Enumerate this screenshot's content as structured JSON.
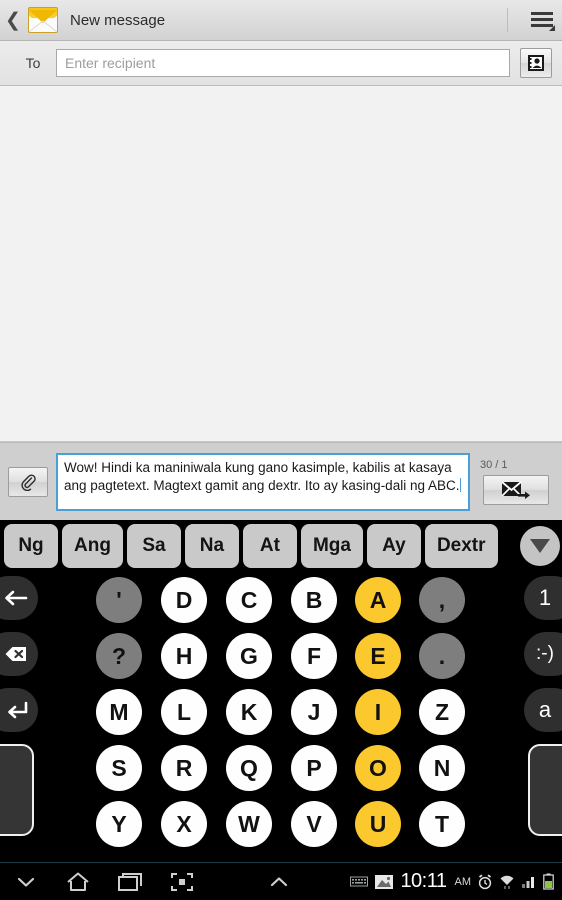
{
  "titlebar": {
    "back_icon": "back-chevron-icon",
    "app_icon": "envelope-icon",
    "title": "New message",
    "menu_icon": "hamburger-menu-icon"
  },
  "recipient": {
    "label": "To",
    "placeholder": "Enter recipient",
    "value": "",
    "contacts_icon": "contacts-person-icon"
  },
  "compose": {
    "attach_icon": "paperclip-icon",
    "message_text": "Wow! Hindi ka maniniwala kung gano kasimple, kabilis at kasaya ang pagtetext. Magtext gamit ang dextr. Ito ay kasing-dali ng ABC.",
    "char_count": "30 / 1",
    "send_icon": "send-envelope-arrow-icon",
    "focus_color": "#4a9fd8"
  },
  "suggestions": {
    "items": [
      "Ng",
      "Ang",
      "Sa",
      "Na",
      "At",
      "Mga",
      "Ay",
      "Dextr"
    ],
    "more_icon": "chevron-down-icon"
  },
  "keyboard": {
    "colors": {
      "background": "#000000",
      "letter_key": "#fefefe",
      "vowel_key": "#fbc82e",
      "punct_key": "#7e7e7e",
      "edge_key": "#2f2f2f"
    },
    "rows": [
      {
        "left_edge": {
          "label": "←",
          "name": "cursor-left-key"
        },
        "keys": [
          {
            "label": "'",
            "type": "gray"
          },
          {
            "label": "D",
            "type": "white"
          },
          {
            "label": "C",
            "type": "white"
          },
          {
            "label": "B",
            "type": "white"
          },
          {
            "label": "A",
            "type": "yellow"
          },
          {
            "label": ",",
            "type": "gray"
          }
        ],
        "right_edge": {
          "label": "1",
          "name": "numbers-mode-key"
        }
      },
      {
        "left_edge": {
          "label": "⌫",
          "name": "backspace-key"
        },
        "keys": [
          {
            "label": "?",
            "type": "gray"
          },
          {
            "label": "H",
            "type": "white"
          },
          {
            "label": "G",
            "type": "white"
          },
          {
            "label": "F",
            "type": "white"
          },
          {
            "label": "E",
            "type": "yellow"
          },
          {
            "label": ".",
            "type": "gray"
          }
        ],
        "right_edge": {
          "label": ":-)",
          "name": "emoji-key"
        }
      },
      {
        "left_edge": {
          "label": "↵",
          "name": "enter-key"
        },
        "keys": [
          {
            "label": "M",
            "type": "white"
          },
          {
            "label": "L",
            "type": "white"
          },
          {
            "label": "K",
            "type": "white"
          },
          {
            "label": "J",
            "type": "white"
          },
          {
            "label": "I",
            "type": "yellow"
          },
          {
            "label": "Z",
            "type": "white"
          }
        ],
        "right_edge": {
          "label": "a",
          "name": "lowercase-mode-key"
        }
      },
      {
        "left_edge": {
          "label": "",
          "name": "space-left-key"
        },
        "keys": [
          {
            "label": "S",
            "type": "white"
          },
          {
            "label": "R",
            "type": "white"
          },
          {
            "label": "Q",
            "type": "white"
          },
          {
            "label": "P",
            "type": "white"
          },
          {
            "label": "O",
            "type": "yellow"
          },
          {
            "label": "N",
            "type": "white"
          }
        ],
        "right_edge": {
          "label": "",
          "name": "space-right-key"
        }
      },
      {
        "left_edge": {
          "label": "",
          "name": "space-left-key-2"
        },
        "keys": [
          {
            "label": "Y",
            "type": "white"
          },
          {
            "label": "X",
            "type": "white"
          },
          {
            "label": "W",
            "type": "white"
          },
          {
            "label": "V",
            "type": "white"
          },
          {
            "label": "U",
            "type": "yellow"
          },
          {
            "label": "T",
            "type": "white"
          }
        ],
        "right_edge": {
          "label": "",
          "name": "space-right-key-2"
        }
      }
    ]
  },
  "navbar": {
    "buttons": [
      "hide-keyboard-icon",
      "home-icon",
      "recents-icon",
      "screenshot-icon",
      "expand-up-icon"
    ],
    "status": {
      "keyboard_icon": "keyboard-status-icon",
      "image_icon": "screenshot-saved-icon",
      "time": "10:11",
      "ampm": "AM",
      "alarm_icon": "alarm-icon",
      "wifi_icon": "wifi-icon",
      "signal_icon": "signal-bars-icon",
      "battery_icon": "battery-icon",
      "battery_color": "#8cc63f"
    }
  }
}
